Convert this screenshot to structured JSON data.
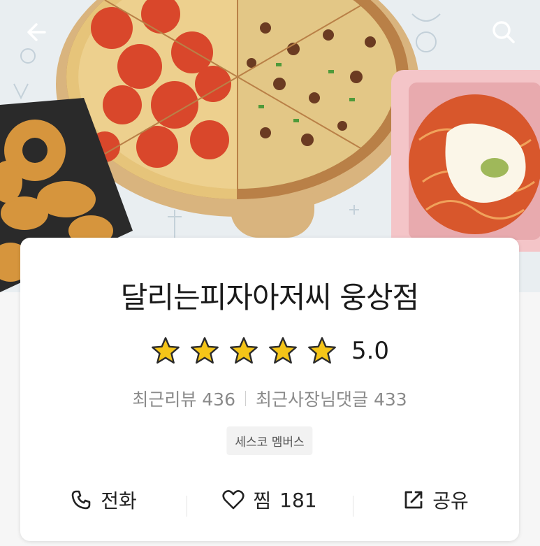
{
  "restaurant": {
    "name": "달리는피자아저씨 웅상점",
    "rating": "5.0",
    "star_count": 5,
    "recent_reviews_label": "최근리뷰",
    "recent_reviews_count": "436",
    "owner_replies_label": "최근사장님댓글",
    "owner_replies_count": "433",
    "badge": "세스코 멤버스"
  },
  "actions": {
    "call_label": "전화",
    "like_label": "찜",
    "like_count": "181",
    "share_label": "공유"
  },
  "icons": {
    "back": "back-arrow-icon",
    "search": "search-icon",
    "star": "star-icon",
    "phone": "phone-icon",
    "heart": "heart-icon",
    "share": "share-icon"
  },
  "colors": {
    "star_fill": "#f5c518",
    "star_stroke": "#2b2b2b",
    "text_primary": "#1a1a1a",
    "text_secondary": "#8a8a8a"
  }
}
